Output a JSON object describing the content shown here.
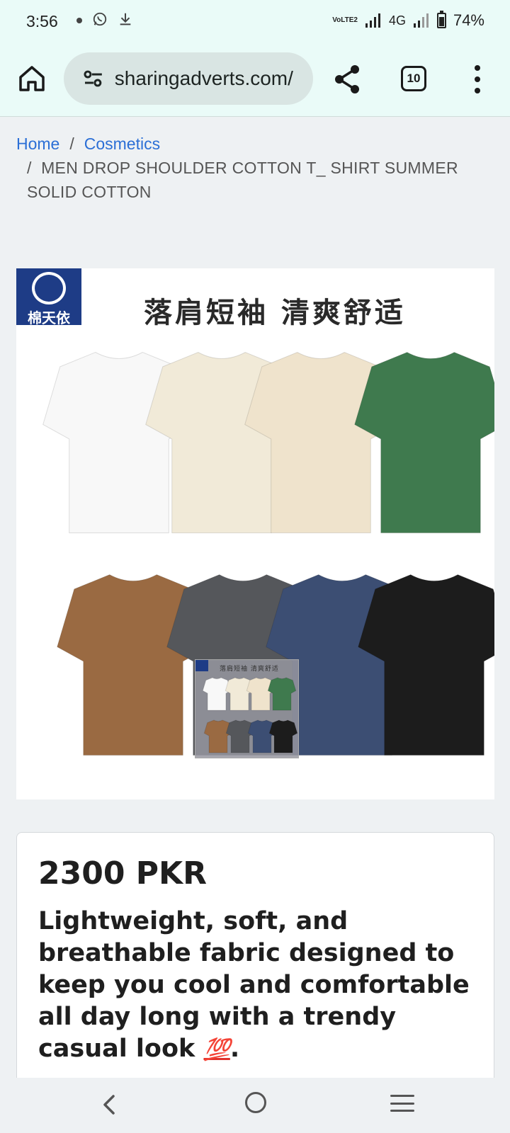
{
  "status_bar": {
    "time": "3:56",
    "network_label": "VoLTE2",
    "network_type": "4G",
    "battery_percent": 74,
    "battery_text": "74%"
  },
  "browser": {
    "url": "sharingadverts.com/",
    "tab_count": "10"
  },
  "breadcrumb": {
    "items": [
      {
        "label": "Home"
      },
      {
        "label": "Cosmetics"
      }
    ],
    "separator": "/",
    "current": "MEN DROP SHOULDER COTTON T_ SHIRT SUMMER SOLID COTTON"
  },
  "product_image": {
    "brand_logo_text": "棉天依",
    "banner_text": "落肩短袖  清爽舒适",
    "shirt_colors": [
      "#f8f8f8",
      "#f1ead8",
      "#efe3cc",
      "#3f7a4e",
      "#9a6a42",
      "#55575b",
      "#3c4e73",
      "#1c1c1c"
    ]
  },
  "product": {
    "price": "2300 PKR",
    "description": "Lightweight, soft, and breathable fabric designed to keep you cool and comfortable all day long with a trendy casual look ",
    "emoji": "💯",
    "description_end": "."
  }
}
